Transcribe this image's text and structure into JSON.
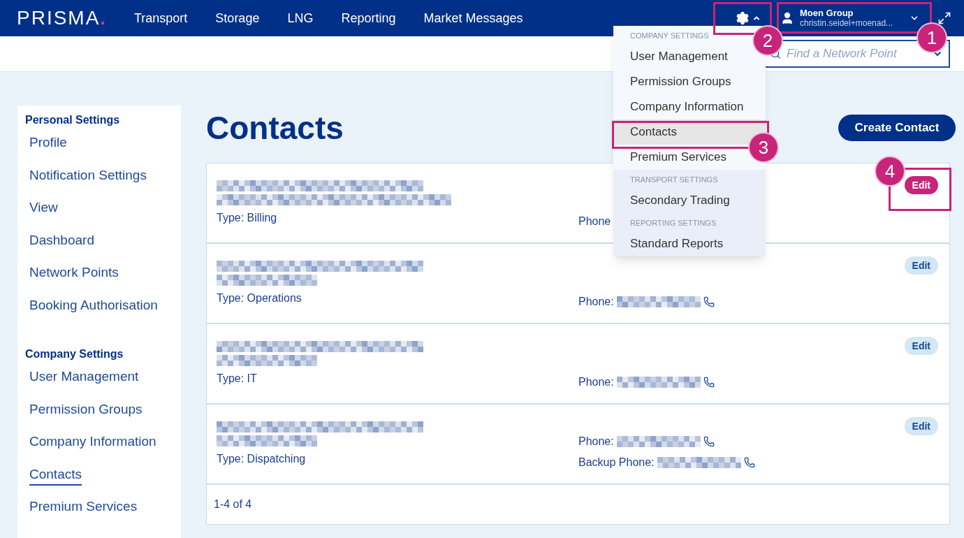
{
  "logo": {
    "text": "PRISMA",
    "dot": "."
  },
  "nav": [
    {
      "label": "Transport"
    },
    {
      "label": "Storage"
    },
    {
      "label": "LNG"
    },
    {
      "label": "Reporting"
    },
    {
      "label": "Market Messages"
    }
  ],
  "account": {
    "name": "Moen Group",
    "email": "christin.seidel+moenad..."
  },
  "search": {
    "placeholder": "Find a Network Point"
  },
  "sidebar": [
    {
      "heading": "Personal Settings",
      "items": [
        {
          "label": "Profile",
          "selected": false
        },
        {
          "label": "Notification Settings",
          "selected": false
        },
        {
          "label": "View",
          "selected": false
        },
        {
          "label": "Dashboard",
          "selected": false
        },
        {
          "label": "Network Points",
          "selected": false
        },
        {
          "label": "Booking Authorisation",
          "selected": false
        }
      ]
    },
    {
      "heading": "Company Settings",
      "items": [
        {
          "label": "User Management",
          "selected": false
        },
        {
          "label": "Permission Groups",
          "selected": false
        },
        {
          "label": "Company Information",
          "selected": false
        },
        {
          "label": "Contacts",
          "selected": true
        },
        {
          "label": "Premium Services",
          "selected": false
        }
      ]
    }
  ],
  "page_title": "Contacts",
  "create_button": "Create Contact",
  "contacts": [
    {
      "type": "Type: Billing",
      "phones": [
        {
          "label": "Phone",
          "redacted": false
        }
      ],
      "edit": "Edit",
      "highlighted": true
    },
    {
      "type": "Type: Operations",
      "phones": [
        {
          "label": "Phone:",
          "redacted": true
        }
      ],
      "edit": "Edit",
      "highlighted": false
    },
    {
      "type": "Type: IT",
      "phones": [
        {
          "label": "Phone:",
          "redacted": true
        }
      ],
      "edit": "Edit",
      "highlighted": false
    },
    {
      "type": "Type: Dispatching",
      "phones": [
        {
          "label": "Phone:",
          "redacted": true
        },
        {
          "label": "Backup Phone:",
          "redacted": true
        }
      ],
      "edit": "Edit",
      "highlighted": false
    }
  ],
  "pagination": "1-4 of 4",
  "settings_menu": {
    "groups": [
      {
        "header": "COMPANY SETTINGS",
        "shaded": false,
        "items": [
          {
            "label": "User Management",
            "selected": false
          },
          {
            "label": "Permission Groups",
            "selected": false
          },
          {
            "label": "Company Information",
            "selected": false
          },
          {
            "label": "Contacts",
            "selected": true
          },
          {
            "label": "Premium Services",
            "selected": false
          }
        ]
      },
      {
        "header": "TRANSPORT SETTINGS",
        "shaded": true,
        "items": [
          {
            "label": "Secondary Trading",
            "selected": false
          }
        ]
      },
      {
        "header": "REPORTING SETTINGS",
        "shaded": true,
        "items": [
          {
            "label": "Standard Reports",
            "selected": false
          }
        ]
      }
    ]
  },
  "callouts": [
    {
      "number": "1"
    },
    {
      "number": "2"
    },
    {
      "number": "3"
    },
    {
      "number": "4"
    }
  ]
}
